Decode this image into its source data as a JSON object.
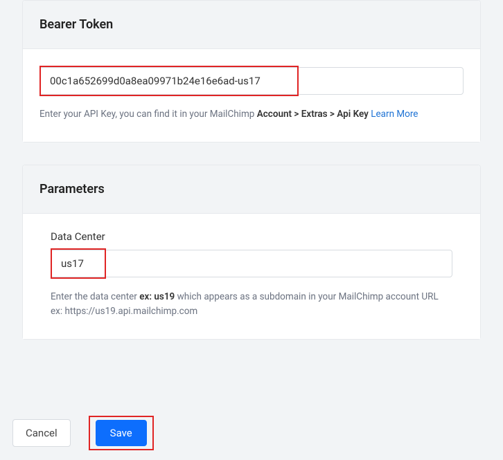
{
  "bearerToken": {
    "title": "Bearer Token",
    "value": "00c1a652699d0a8ea09971b24e16e6ad-us17",
    "helpText1": "Enter your API Key, you can find it in your MailChimp ",
    "helpBold": "Account > Extras > Api Key",
    "learnMore": "Learn More"
  },
  "parameters": {
    "title": "Parameters",
    "dataCenter": {
      "label": "Data Center",
      "value": "us17",
      "help1": "Enter the data center ",
      "helpBold": "ex: us19",
      "help2": " which appears as a subdomain in your MailChimp account URL ex: https://us19.api.mailchimp.com"
    }
  },
  "actions": {
    "cancel": "Cancel",
    "save": "Save"
  }
}
